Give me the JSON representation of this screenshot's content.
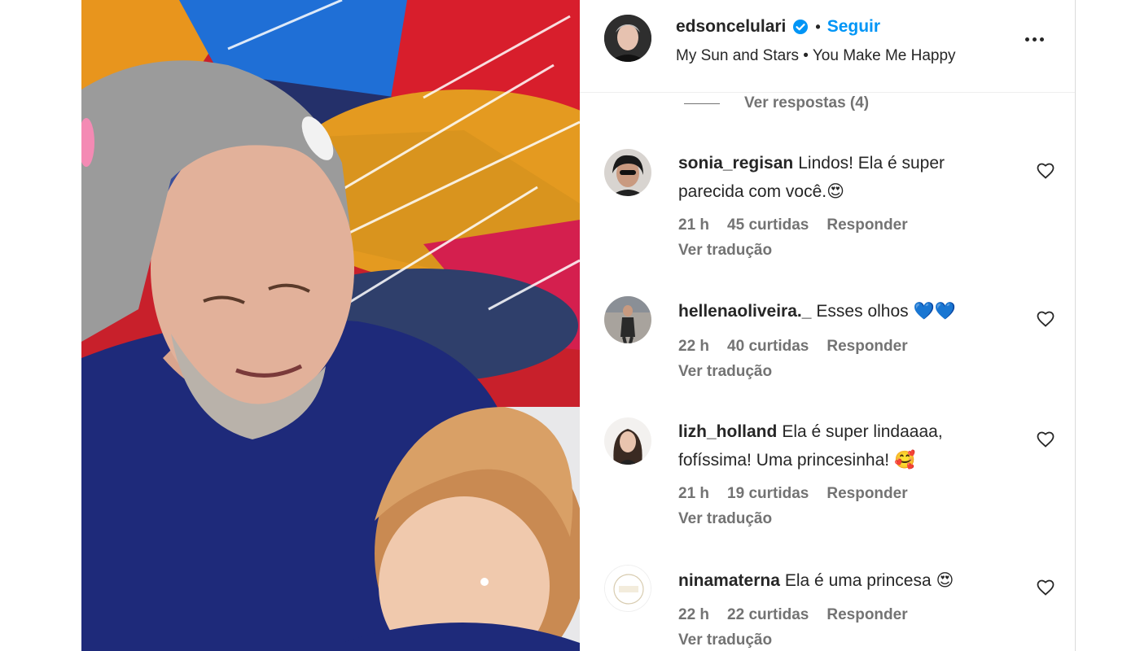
{
  "post": {
    "username": "edsoncelulari",
    "follow_label": "Seguir",
    "separator": "•",
    "audio": "My Sun and Stars • You Make Me Happy",
    "more_label": "Mais opções"
  },
  "replies": {
    "label": "Ver respostas (4)"
  },
  "comments": [
    {
      "username": "sonia_regisan",
      "text": "Lindos! Ela é super parecida com você.",
      "emoji": "😍",
      "time": "21 h",
      "likes": "45 curtidas",
      "reply": "Responder",
      "translate": "Ver tradução"
    },
    {
      "username": "hellenaoliveira._",
      "text": "Esses olhos",
      "emoji": "💙💙",
      "time": "22 h",
      "likes": "40 curtidas",
      "reply": "Responder",
      "translate": "Ver tradução"
    },
    {
      "username": "lizh_holland",
      "text": "Ela é super lindaaaa, fofíssima! Uma princesinha!",
      "emoji": "🥰",
      "time": "21 h",
      "likes": "19 curtidas",
      "reply": "Responder",
      "translate": "Ver tradução"
    },
    {
      "username": "ninamaterna",
      "text": "Ela é uma princesa",
      "emoji": "😍",
      "time": "22 h",
      "likes": "22 curtidas",
      "reply": "Responder",
      "translate": "Ver tradução"
    }
  ],
  "colors": {
    "accent": "#0095f6",
    "verified": "#0095f6",
    "text": "#262626",
    "muted": "#737373"
  }
}
